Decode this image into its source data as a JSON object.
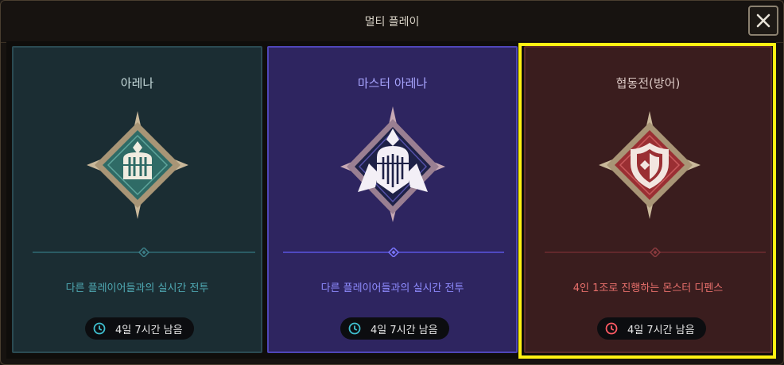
{
  "window": {
    "title": "멀티 플레이",
    "close_icon": "close-icon"
  },
  "modes": [
    {
      "title": "아레나",
      "description": "다른 플레이어들과의 실시간 전투",
      "timer": "4일 7시간 남음",
      "emblem_icon": "arena-helmet-emblem-icon",
      "accent_color": "#4fa9b3",
      "selected": false
    },
    {
      "title": "마스터 아레나",
      "description": "다른 플레이어들과의 실시간 전투",
      "timer": "4일 7시간 남음",
      "emblem_icon": "master-arena-knight-emblem-icon",
      "accent_color": "#8f8cff",
      "selected": false
    },
    {
      "title": "협동전(방어)",
      "description": "4인 1조로 진행하는 몬스터 디펜스",
      "timer": "4일 7시간 남음",
      "emblem_icon": "coop-shield-emblem-icon",
      "accent_color": "#e8706c",
      "selected": true
    }
  ],
  "colors": {
    "selection_highlight": "#fff112",
    "background": "#171310"
  }
}
